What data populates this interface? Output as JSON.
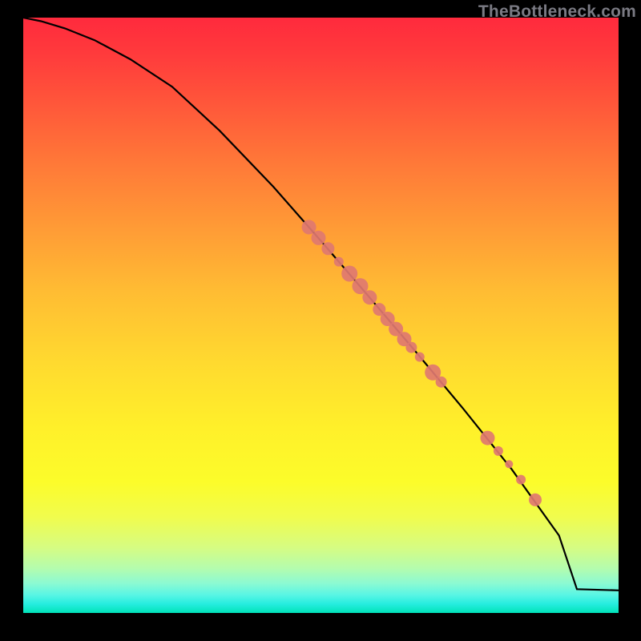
{
  "watermark": "TheBottleneck.com",
  "chart_data": {
    "type": "line",
    "title": "",
    "xlabel": "",
    "ylabel": "",
    "xlim": [
      0,
      100
    ],
    "ylim": [
      0,
      100
    ],
    "grid": false,
    "series": [
      {
        "name": "curve",
        "x": [
          0,
          3,
          7,
          12,
          18,
          25,
          33,
          42,
          50,
          58,
          66,
          74,
          82,
          90,
          93,
          100
        ],
        "y": [
          100,
          99.4,
          98.2,
          96.2,
          93.0,
          88.4,
          81.0,
          71.6,
          62.5,
          53.2,
          43.8,
          34.2,
          24.2,
          13.0,
          4.0,
          3.8
        ]
      }
    ],
    "points": [
      {
        "x": 48.0,
        "y": 64.8,
        "r": 9
      },
      {
        "x": 49.6,
        "y": 63.0,
        "r": 9
      },
      {
        "x": 51.2,
        "y": 61.2,
        "r": 8
      },
      {
        "x": 53.0,
        "y": 59.0,
        "r": 6
      },
      {
        "x": 54.8,
        "y": 57.0,
        "r": 10
      },
      {
        "x": 56.6,
        "y": 54.9,
        "r": 10
      },
      {
        "x": 58.2,
        "y": 53.0,
        "r": 9
      },
      {
        "x": 59.8,
        "y": 51.0,
        "r": 8
      },
      {
        "x": 61.2,
        "y": 49.4,
        "r": 9
      },
      {
        "x": 62.6,
        "y": 47.7,
        "r": 9
      },
      {
        "x": 64.0,
        "y": 46.0,
        "r": 9
      },
      {
        "x": 65.2,
        "y": 44.6,
        "r": 7
      },
      {
        "x": 66.6,
        "y": 43.0,
        "r": 6
      },
      {
        "x": 68.8,
        "y": 40.4,
        "r": 10
      },
      {
        "x": 70.2,
        "y": 38.8,
        "r": 7
      },
      {
        "x": 78.0,
        "y": 29.4,
        "r": 9
      },
      {
        "x": 79.8,
        "y": 27.2,
        "r": 6
      },
      {
        "x": 81.6,
        "y": 25.0,
        "r": 5
      },
      {
        "x": 83.6,
        "y": 22.4,
        "r": 6
      },
      {
        "x": 86.0,
        "y": 19.0,
        "r": 8
      }
    ],
    "point_color": "#e07870",
    "line_color": "#000000"
  }
}
